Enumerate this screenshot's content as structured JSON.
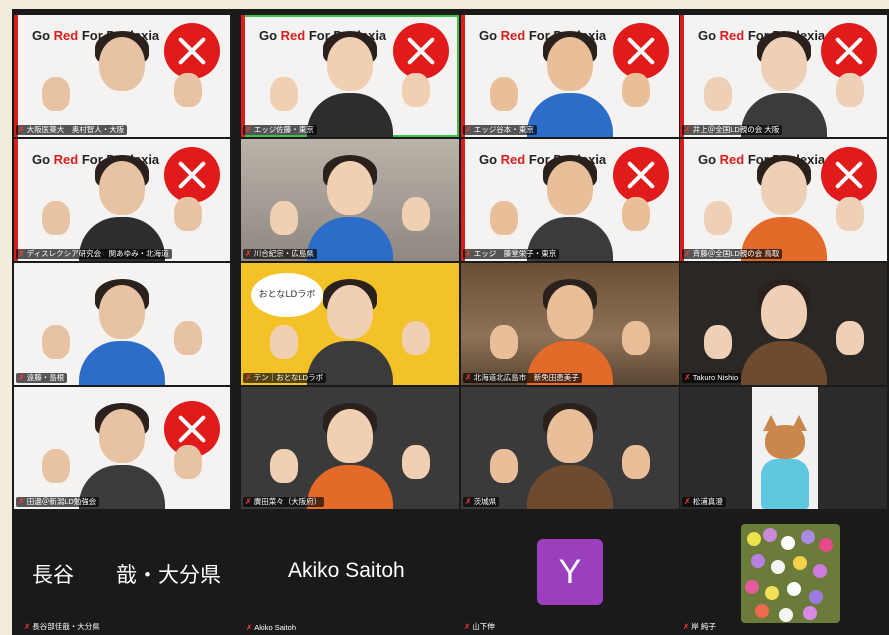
{
  "brand": {
    "go": "Go ",
    "red": "Red",
    "rest": " For Dyslexia"
  },
  "rows": [
    [
      {
        "name": "大阪医薬大　奥村智人・大阪",
        "kind": "brand",
        "active": false
      },
      {
        "name": "エッジ佐藤・東京",
        "kind": "brand",
        "active": true
      },
      {
        "name": "エッジ谷本・東京",
        "kind": "brand",
        "active": false
      },
      {
        "name": "井上＠全国LD親の会 大阪",
        "kind": "brand",
        "active": false
      }
    ],
    [
      {
        "name": "ディスレクシア研究会　関あゆみ・北海道",
        "kind": "brand",
        "active": false
      },
      {
        "name": "川合紀宗・広島県",
        "kind": "room",
        "active": false
      },
      {
        "name": "エッジ　藤堂栄子・東京",
        "kind": "brand",
        "active": false
      },
      {
        "name": "斉藤＠全国LD親の会 鳥取",
        "kind": "brand",
        "active": false
      }
    ],
    [
      {
        "name": "遠藤・島根",
        "kind": "white",
        "active": false
      },
      {
        "name": "テン｜おとなLDラボ",
        "kind": "yellow",
        "active": false,
        "sign": "おとなLDラボ"
      },
      {
        "name": "北海道北広島市　新免田恵美子",
        "kind": "wood",
        "active": false
      },
      {
        "name": "Takuro Nishio",
        "kind": "dark",
        "active": false
      }
    ],
    [
      {
        "name": "田邊＠新潟LD勉強会",
        "kind": "logo-only",
        "active": false
      },
      {
        "name": "廣田菜々（大阪府）",
        "kind": "gray",
        "active": false
      },
      {
        "name": "茨城県",
        "kind": "gray",
        "active": false
      },
      {
        "name": "松浦真澄",
        "kind": "corgi",
        "active": false
      }
    ]
  ],
  "bottom": {
    "tile1_text": "長谷　　戠・大分県",
    "tile1_name": "長谷部佳戠・大分県",
    "tile2_text": "Akiko Saitoh",
    "tile2_name": "Akiko Saitoh",
    "tile3_avatar": "Y",
    "tile3_name": "山下伸",
    "tile4_name": "岸 純子"
  },
  "mic_icon": "mic-muted-icon",
  "colors": {
    "accent_red": "#d91e1e",
    "active_border": "#3fbf4a",
    "avatar_purple": "#9a3fbd"
  }
}
